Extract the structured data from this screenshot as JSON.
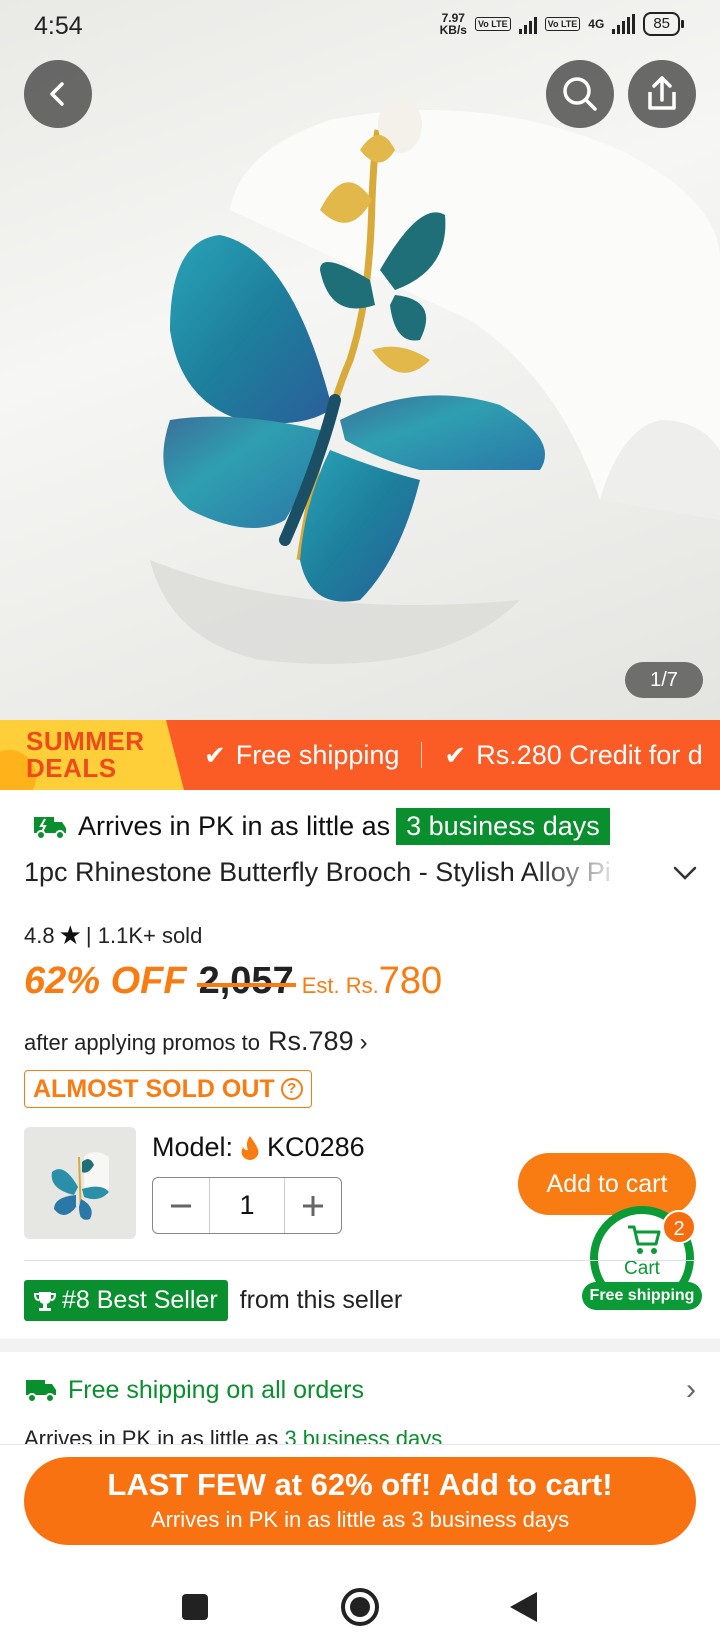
{
  "status_bar": {
    "time": "4:54",
    "net_speed_value": "7.97",
    "net_speed_unit": "KB/s",
    "sim1_label": "Vo LTE",
    "sim2_label": "Vo LTE",
    "network_type": "4G",
    "battery": "85"
  },
  "hero": {
    "image_counter": "1/7",
    "icons": {
      "back": "back-arrow-icon",
      "search": "search-icon",
      "share": "share-icon"
    }
  },
  "deals_banner": {
    "title_line1": "SUMMER",
    "title_line2": "DEALS",
    "item1": "Free shipping",
    "item2": "Rs.280 Credit for d"
  },
  "product": {
    "arrival_prefix": "Arrives in PK in as little as",
    "arrival_days": "3 business days",
    "title": "1pc Rhinestone Butterfly Brooch - Stylish Alloy Pi",
    "rating": "4.8",
    "sold": "| 1.1K+ sold",
    "discount": "62% OFF",
    "original_price": "2,057",
    "est_label": "Est. Rs.",
    "est_value": "780",
    "promo_text": "after applying promos to",
    "promo_price": "Rs.789",
    "stock_badge": "ALMOST SOLD OUT",
    "model_label": "Model:",
    "model_value": "KC0286",
    "quantity": "1",
    "add_to_cart": "Add to cart",
    "cart_label": "Cart",
    "cart_count": "2",
    "cart_shipping": "Free shipping",
    "best_seller_badge": "#8 Best Seller",
    "best_seller_suffix": "from this seller"
  },
  "shipping": {
    "title": "Free shipping on all orders",
    "arrival_prefix": "Arrives in PK in as little as",
    "arrival_days": "3 business days"
  },
  "cta": {
    "main": "LAST FEW at 62% off! Add to cart!",
    "sub": "Arrives in PK in as little as 3 business days"
  },
  "colors": {
    "accent_orange": "#f97c12",
    "banner_orange": "#fb5b25",
    "green": "#0a8f2f"
  }
}
